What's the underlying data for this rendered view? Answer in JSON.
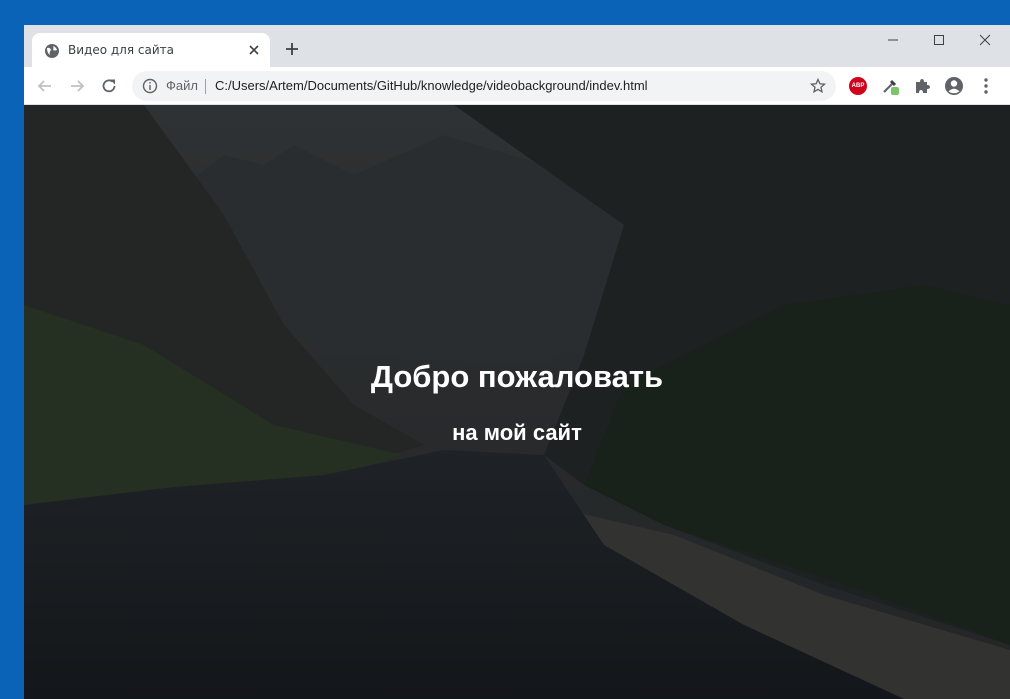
{
  "tab": {
    "title": "Видео для сайта"
  },
  "address": {
    "scheme_label": "Файл",
    "url": "C:/Users/Artem/Documents/GitHub/knowledge/videobackground/indev.html"
  },
  "extensions": {
    "abp_label": "ABP"
  },
  "page": {
    "heading": "Добро пожаловать",
    "subheading": "на мой сайт"
  },
  "icons": [
    "globe-icon",
    "close-icon",
    "plus-icon",
    "minimize-icon",
    "maximize-icon",
    "close-window-icon",
    "back-arrow-icon",
    "forward-arrow-icon",
    "reload-icon",
    "info-icon",
    "star-icon",
    "eyedropper-icon",
    "puzzle-icon",
    "profile-icon",
    "kebab-menu-icon"
  ]
}
